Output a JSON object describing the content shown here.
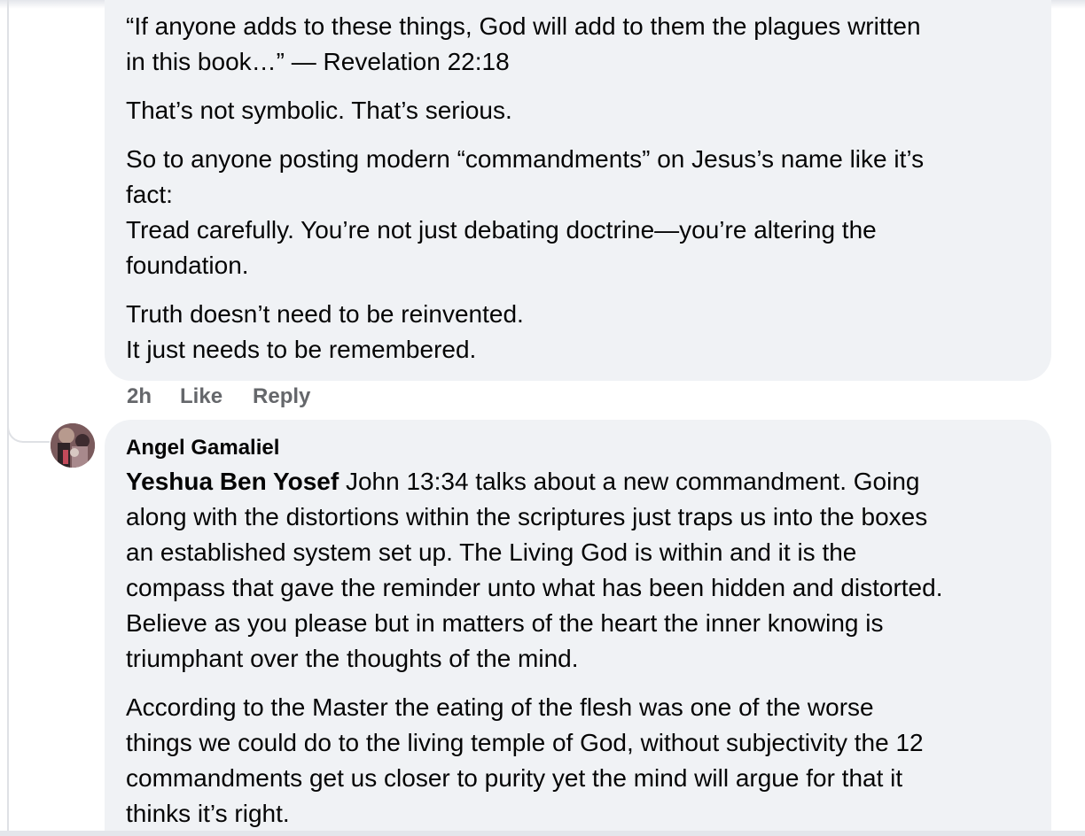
{
  "comment_1": {
    "paragraphs": [
      "“If anyone adds to these things, God will add to them the plagues written\nin this book…” — Revelation 22:18",
      "That’s not symbolic. That’s serious.",
      "So to anyone posting modern “commandments” on Jesus’s name like it’s\nfact:\nTread carefully. You’re not just debating doctrine—you’re altering the\nfoundation.",
      "Truth doesn’t need to be reinvented.\nIt just needs to be remembered."
    ],
    "time": "2h",
    "like_label": "Like",
    "reply_label": "Reply"
  },
  "comment_2": {
    "author": "Angel Gamaliel",
    "mention": "Yeshua Ben Yosef",
    "first_paragraph_text": " John 13:34 talks about a new commandment. Going\nalong with the distortions within the scriptures just traps us into the boxes\nan established system set up. The Living God is within and it is the\ncompass that gave the reminder unto what has been hidden and distorted.\nBelieve as you please but in matters of the heart the inner knowing is\ntriumphant over the thoughts of the mind.",
    "second_paragraph": "According to the Master the eating of the flesh was one of the worse\nthings we could do to the living temple of God, without subjectivity the 12\ncommandments get us closer to purity yet the mind will argue for that it\nthinks it’s right.",
    "avatar_icon": "profile-photo"
  }
}
